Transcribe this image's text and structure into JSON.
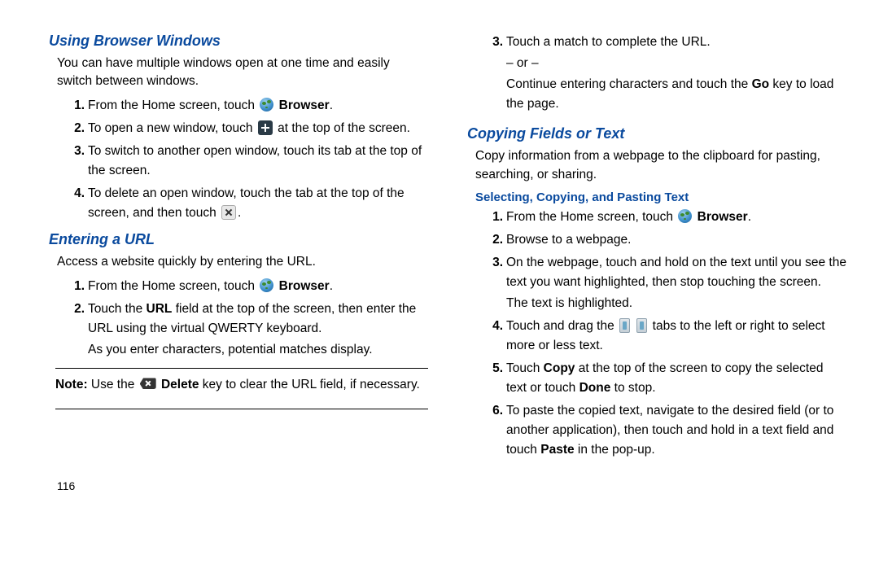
{
  "page_number": "116",
  "left": {
    "h1": "Using Browser Windows",
    "intro": "You can have multiple windows open at one time and easily switch between windows.",
    "s1_a": "From the Home screen, touch ",
    "s1_b": "Browser",
    "s1_c": ".",
    "s2_a": "To open a new window, touch ",
    "s2_b": " at the top of the screen.",
    "s3": "To switch to another open window, touch its tab at the top of the screen.",
    "s4_a": "To delete an open window, touch the tab at the top of the screen, and then touch ",
    "s4_b": ".",
    "h2": "Entering a URL",
    "intro2": "Access a website quickly by entering the URL.",
    "u1_a": "From the Home screen, touch ",
    "u1_b": "Browser",
    "u1_c": ".",
    "u2_a": "Touch the ",
    "u2_b": "URL",
    "u2_c": " field at the top of the screen, then enter the URL using the virtual QWERTY keyboard.",
    "u2_sub": "As you enter characters, potential matches display.",
    "note_label": "Note:",
    "note_a": " Use the ",
    "note_b": "Delete",
    "note_c": " key to clear the URL field, if necessary."
  },
  "right": {
    "r3_a": "Touch a match to complete the URL.",
    "r3_or": "– or –",
    "r3_b1": "Continue entering characters and touch the ",
    "r3_b2": "Go",
    "r3_b3": " key to load the page.",
    "h3": "Copying Fields or Text",
    "intro3": "Copy information from a webpage to the clipboard for pasting, searching, or sharing.",
    "h4": "Selecting, Copying, and Pasting Text",
    "c1_a": "From the Home screen, touch ",
    "c1_b": "Browser",
    "c1_c": ".",
    "c2": "Browse to a webpage.",
    "c3": "On the webpage, touch and hold on the text until you see the text you want highlighted, then stop touching the screen.",
    "c3_sub": "The text is highlighted.",
    "c4_a": "Touch and drag the ",
    "c4_b": " tabs to the left or right to select more or less text.",
    "c5_a": "Touch ",
    "c5_b": "Copy",
    "c5_c": " at the top of the screen to copy the selected text or touch ",
    "c5_d": "Done",
    "c5_e": " to stop.",
    "c6_a": "To paste the copied text, navigate to the desired field (or to another application), then touch and hold in a text field and touch ",
    "c6_b": "Paste",
    "c6_c": " in the pop-up."
  }
}
